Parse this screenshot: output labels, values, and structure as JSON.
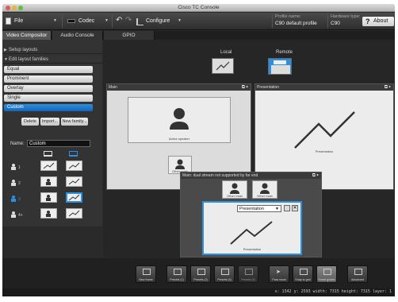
{
  "window": {
    "title": "Cisco TC Console"
  },
  "menubar": {
    "file": "File",
    "codec": "Codec",
    "configure": "Configure",
    "profile_label": "Profile name:",
    "profile_value": "C90 default profile",
    "hardware_label": "Hardware type:",
    "hardware_value": "C90",
    "about": "About"
  },
  "tabs": [
    "Video Compositor",
    "Audio Console",
    "GPIO"
  ],
  "sidebar": {
    "setup_layouts": "Setup layouts",
    "edit_layout_families": "Edit layout families",
    "families": [
      "Equal",
      "Prominent",
      "Overlay",
      "Single",
      "Custom"
    ],
    "selected_family": "Custom",
    "buttons": {
      "delete": "Delete",
      "import": "Import...",
      "new_family": "New family..."
    },
    "name_label": "Name:",
    "name_value": "Custom",
    "row_badges": [
      "1",
      "2",
      "3",
      "4+"
    ]
  },
  "canvas": {
    "local_label": "Local",
    "remote_label": "Remote",
    "main_panel_title": "Main",
    "presentation_panel_title": "Presentation",
    "active_speaker": "Active speaker",
    "other_main": "Other main",
    "presentation_label": "Presentation",
    "dual_panel_title": "Main: dual stream not supported by far end",
    "dual_other_main_1": "Other main",
    "dual_other_main_2": "Other main",
    "dual_select_value": "Presentation",
    "dual_presentation_label": "Presentation"
  },
  "toolbar": {
    "buttons": [
      "New frame",
      "Presets (1)",
      "Presets (2)",
      "Presets (4)",
      "Presets (5)",
      "Para mova",
      "Snap to grid",
      "Smart guides",
      "Advanced"
    ]
  },
  "statusbar": {
    "text": "x: 1342 y: 2593 width: 7315 height: 7315 layer: 1"
  }
}
